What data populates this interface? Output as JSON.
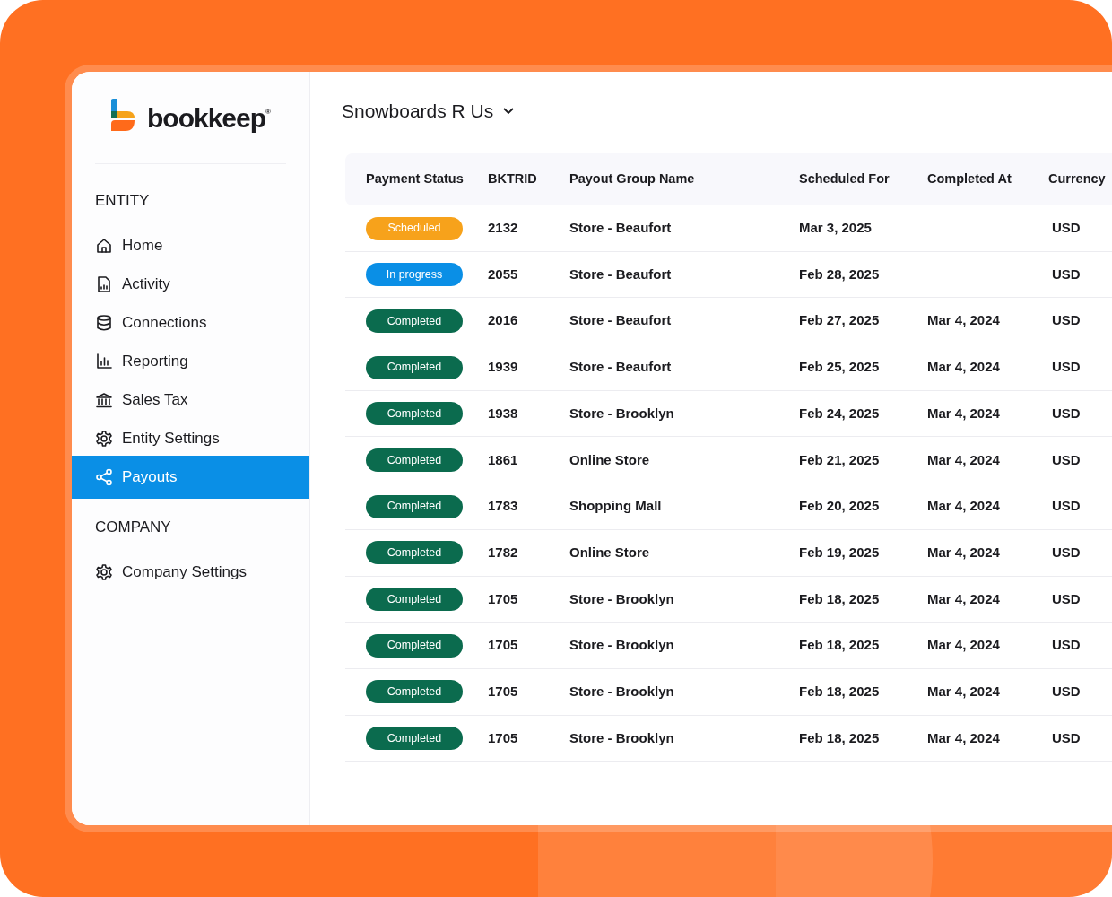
{
  "logo": {
    "text": "bookkeep",
    "mark": "®"
  },
  "sidebar": {
    "sections": [
      {
        "heading": "ENTITY",
        "items": [
          {
            "label": "Home",
            "kind": "home",
            "selected": false
          },
          {
            "label": "Activity",
            "kind": "activity",
            "selected": false
          },
          {
            "label": "Connections",
            "kind": "connections",
            "selected": false
          },
          {
            "label": "Reporting",
            "kind": "reporting",
            "selected": false
          },
          {
            "label": "Sales Tax",
            "kind": "tax",
            "selected": false
          },
          {
            "label": "Entity Settings",
            "kind": "settings",
            "selected": false
          },
          {
            "label": "Payouts",
            "kind": "payouts",
            "selected": true
          }
        ]
      },
      {
        "heading": "COMPANY",
        "items": [
          {
            "label": "Company Settings",
            "kind": "settings",
            "selected": false
          }
        ]
      }
    ]
  },
  "entity_selector": {
    "label": "Snowboards R Us"
  },
  "table": {
    "columns": [
      "Payment Status",
      "BKTRID",
      "Payout Group Name",
      "Scheduled For",
      "Completed At",
      "Currency"
    ],
    "rows": [
      {
        "status": {
          "label": "Scheduled",
          "kind": "scheduled"
        },
        "bktrid": "2132",
        "group": "Store - Beaufort",
        "scheduled_for": "Mar 3, 2025",
        "currency": "USD"
      },
      {
        "status": {
          "label": "In progress",
          "kind": "in_progress"
        },
        "bktrid": "2055",
        "group": "Store - Beaufort",
        "scheduled_for": "Feb 28, 2025",
        "currency": "USD"
      },
      {
        "status": {
          "label": "Completed",
          "kind": "completed"
        },
        "bktrid": "2016",
        "group": "Store - Beaufort",
        "scheduled_for": "Feb 27, 2025",
        "completed_at": "Mar 4, 2024",
        "currency": "USD"
      },
      {
        "status": {
          "label": "Completed",
          "kind": "completed"
        },
        "bktrid": "1939",
        "group": "Store - Beaufort",
        "scheduled_for": "Feb 25, 2025",
        "completed_at": "Mar 4, 2024",
        "currency": "USD"
      },
      {
        "status": {
          "label": "Completed",
          "kind": "completed"
        },
        "bktrid": "1938",
        "group": "Store - Brooklyn",
        "scheduled_for": "Feb 24, 2025",
        "completed_at": "Mar 4, 2024",
        "currency": "USD"
      },
      {
        "status": {
          "label": "Completed",
          "kind": "completed"
        },
        "bktrid": "1861",
        "group": "Online Store",
        "scheduled_for": "Feb 21, 2025",
        "completed_at": "Mar 4, 2024",
        "currency": "USD"
      },
      {
        "status": {
          "label": "Completed",
          "kind": "completed"
        },
        "bktrid": "1783",
        "group": "Shopping Mall",
        "scheduled_for": "Feb 20, 2025",
        "completed_at": "Mar 4, 2024",
        "currency": "USD"
      },
      {
        "status": {
          "label": "Completed",
          "kind": "completed"
        },
        "bktrid": "1782",
        "group": "Online Store",
        "scheduled_for": "Feb 19, 2025",
        "completed_at": "Mar 4, 2024",
        "currency": "USD"
      },
      {
        "status": {
          "label": "Completed",
          "kind": "completed"
        },
        "bktrid": "1705",
        "group": "Store - Brooklyn",
        "scheduled_for": "Feb 18, 2025",
        "completed_at": "Mar 4, 2024",
        "currency": "USD"
      },
      {
        "status": {
          "label": "Completed",
          "kind": "completed"
        },
        "bktrid": "1705",
        "group": "Store - Brooklyn",
        "scheduled_for": "Feb 18, 2025",
        "completed_at": "Mar 4, 2024",
        "currency": "USD"
      },
      {
        "status": {
          "label": "Completed",
          "kind": "completed"
        },
        "bktrid": "1705",
        "group": "Store - Brooklyn",
        "scheduled_for": "Feb 18, 2025",
        "completed_at": "Mar 4, 2024",
        "currency": "USD"
      },
      {
        "status": {
          "label": "Completed",
          "kind": "completed"
        },
        "bktrid": "1705",
        "group": "Store - Brooklyn",
        "scheduled_for": "Feb 18, 2025",
        "completed_at": "Mar 4, 2024",
        "currency": "USD"
      }
    ]
  }
}
